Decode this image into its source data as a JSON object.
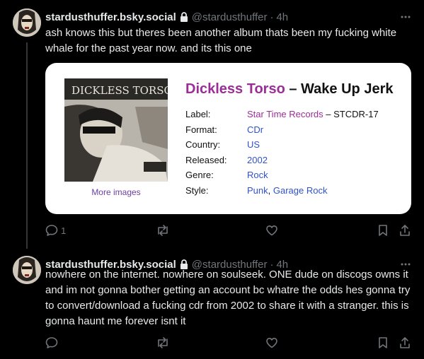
{
  "posts": [
    {
      "author": {
        "display_name": "stardusthuffer.bsky.social",
        "handle": "@stardusthuffer",
        "time": "4h"
      },
      "text": "ash knows this but theres been another album thats been my fucking white whale for the past year now. and its this one",
      "card": {
        "artist": "Dickless Torso",
        "album_title": " – Wake Up Jerk",
        "more_images": "More images",
        "cover_text": "DICKLESS TORSO",
        "details": [
          {
            "key": "Label:",
            "value": "Star Time Records",
            "suffix": " – STCDR-17"
          },
          {
            "key": "Format:",
            "value": "CDr"
          },
          {
            "key": "Country:",
            "value": "US"
          },
          {
            "key": "Released:",
            "value": "2002"
          },
          {
            "key": "Genre:",
            "value": "Rock"
          },
          {
            "key": "Style:",
            "value": "Punk",
            "value2": "Garage Rock"
          }
        ]
      },
      "actions": {
        "reply_count": "1"
      }
    },
    {
      "author": {
        "display_name": "stardusthuffer.bsky.social",
        "handle": "@stardusthuffer",
        "time": "4h"
      },
      "text": "nowhere on the internet. nowhere on soulseek. ONE dude on discogs owns it and im not gonna bother getting an account bc whatre the odds hes gonna try to convert/download a fucking cdr from 2002 to share it with a stranger. this is gonna haunt me forever isnt it",
      "actions": {
        "reply_count": ""
      }
    }
  ],
  "colors": {
    "background": "#000000",
    "text": "#e7e9ea",
    "muted": "#71767b",
    "link_blue": "#3152c9",
    "artist_purple": "#9b2e96"
  },
  "icons": [
    "lock-icon",
    "more-icon",
    "reply-icon",
    "repost-icon",
    "like-icon",
    "bookmark-icon",
    "share-icon"
  ]
}
